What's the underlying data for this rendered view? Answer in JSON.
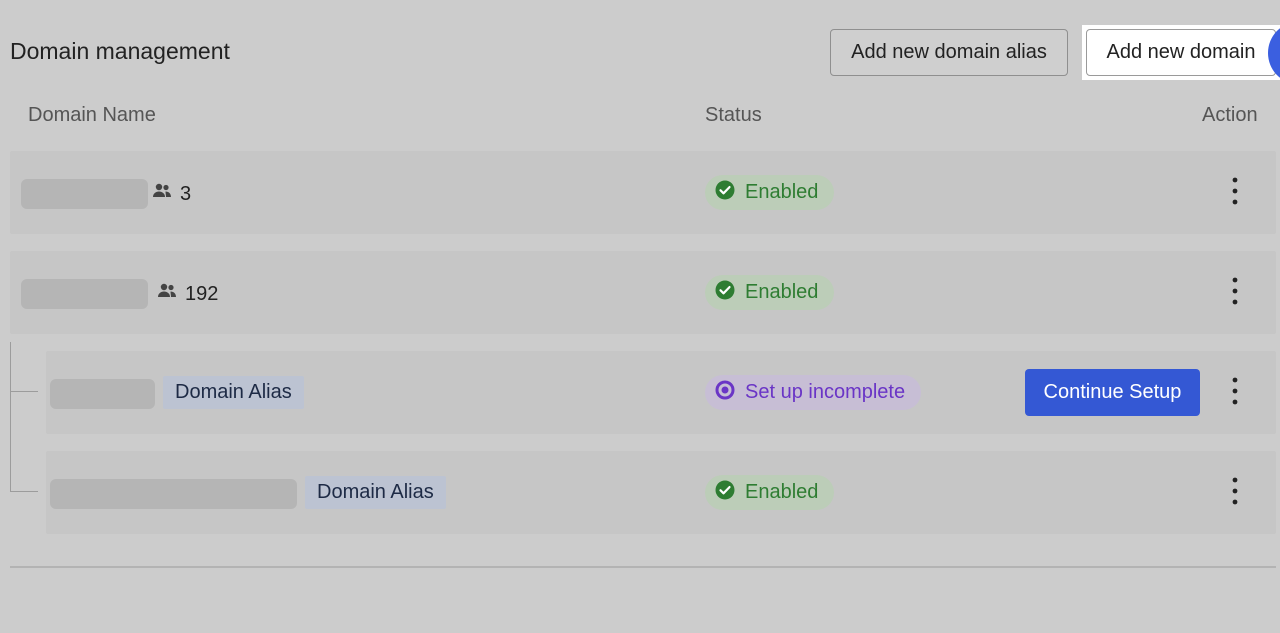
{
  "page_title": "Domain management",
  "buttons": {
    "add_alias": "Add new domain alias",
    "add_domain": "Add new domain",
    "continue_setup": "Continue Setup"
  },
  "columns": {
    "name": "Domain Name",
    "status": "Status",
    "action": "Action"
  },
  "rows": [
    {
      "users": "3",
      "status": "Enabled",
      "status_type": "enabled"
    },
    {
      "users": "192",
      "status": "Enabled",
      "status_type": "enabled"
    },
    {
      "tag": "Domain Alias",
      "status": "Set up incomplete",
      "status_type": "incomplete"
    },
    {
      "tag": "Domain Alias",
      "status": "Enabled",
      "status_type": "enabled"
    }
  ],
  "colors": {
    "enabled": "#2e7d32",
    "incomplete": "#6a35c6",
    "primary": "#3458d4"
  },
  "icons": {
    "users": "users-icon",
    "enabled": "check-circle-icon",
    "incomplete": "target-circle-icon",
    "action": "kebab-menu-icon"
  }
}
